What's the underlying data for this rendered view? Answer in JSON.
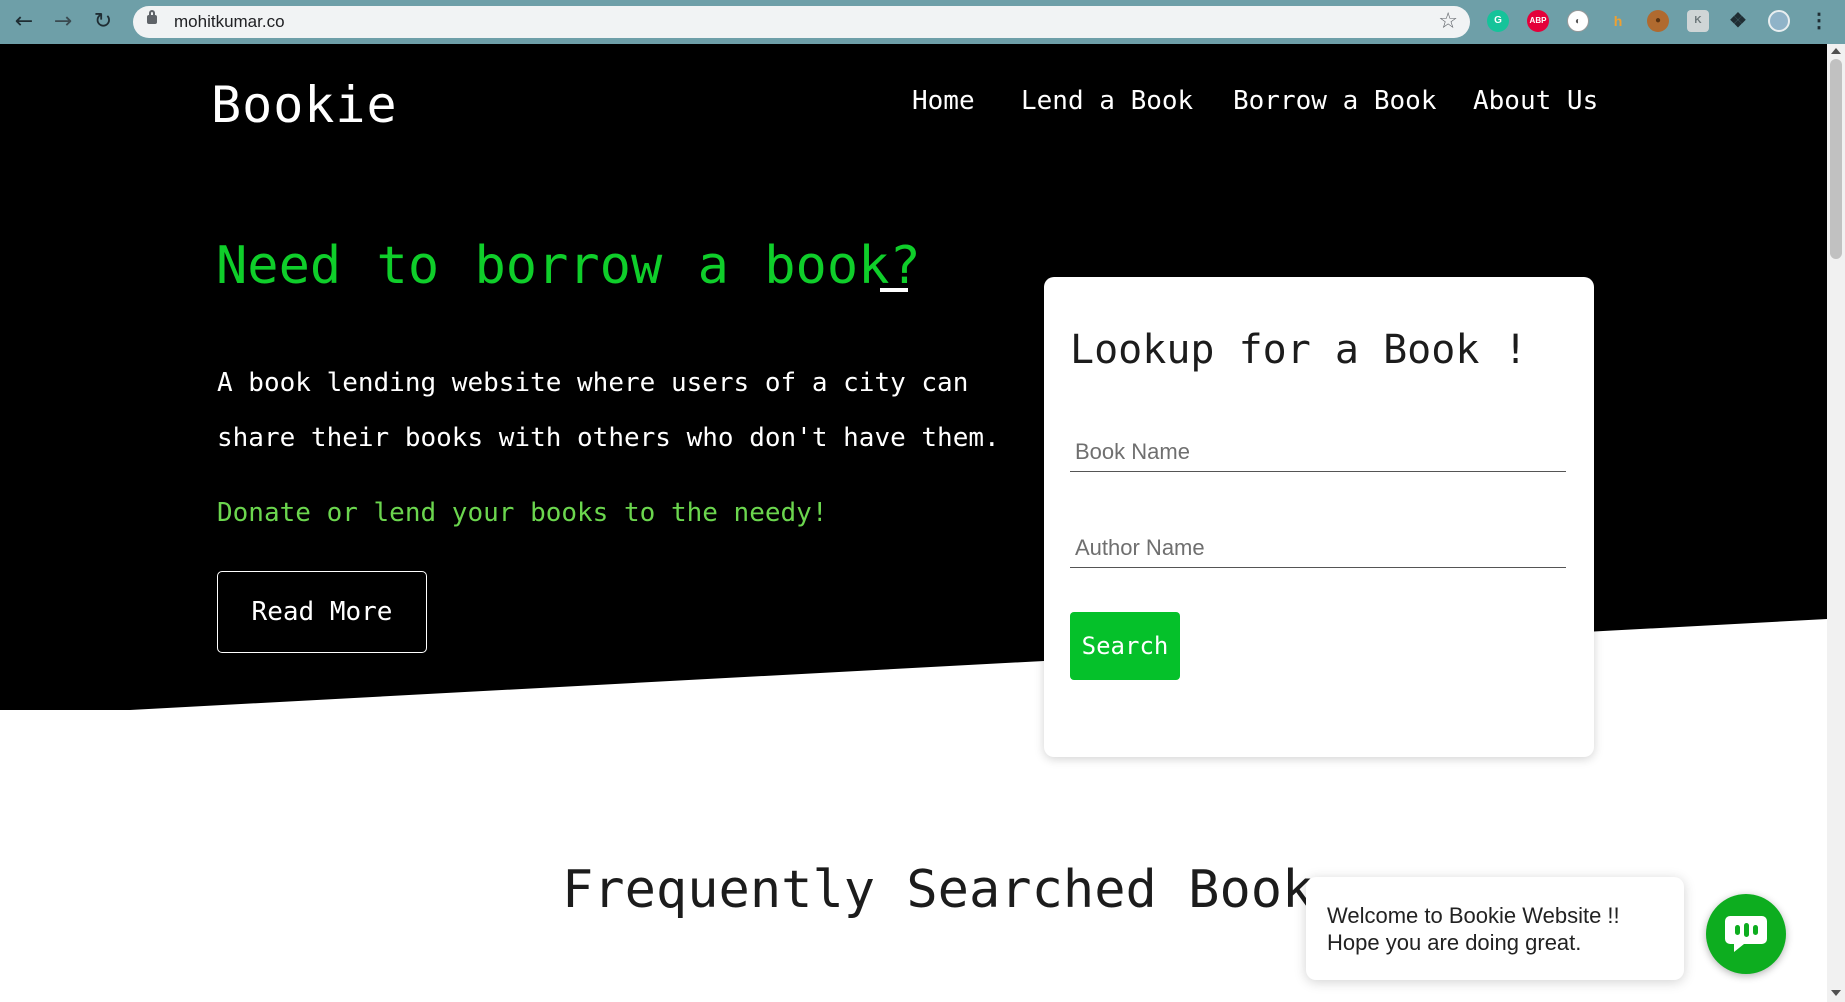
{
  "browser": {
    "url": "mohitkumar.co",
    "extensions": [
      {
        "name": "grammarly-icon",
        "label": "G",
        "color": "#15c39a"
      },
      {
        "name": "adblock-icon",
        "label": "ABP",
        "color": "#e4003a"
      },
      {
        "name": "extension-circle-icon",
        "label": "◐",
        "color": "#ffffff"
      },
      {
        "name": "honey-icon",
        "label": "h",
        "color": "#f0a030"
      },
      {
        "name": "cookie-icon",
        "label": "●",
        "color": "#b06a2f"
      },
      {
        "name": "extension-k-icon",
        "label": "K",
        "color": "#9aa6aa"
      }
    ]
  },
  "site": {
    "logo": "Bookie",
    "nav": [
      "Home",
      "Lend a Book",
      "Borrow a Book",
      "About Us"
    ]
  },
  "hero": {
    "headline": "Need to borrow a book?",
    "description": "A book lending website where users of a city can share their books with others who don't have them.",
    "tagline": "Donate or lend your books to the needy!",
    "cta": "Read More"
  },
  "lookup": {
    "title": "Lookup for a Book !",
    "book_placeholder": "Book Name",
    "author_placeholder": "Author Name",
    "search_label": "Search"
  },
  "section": {
    "title": "Frequently Searched Books"
  },
  "chat": {
    "line1": "Welcome to Bookie Website !!",
    "line2": "Hope you are doing great."
  },
  "colors": {
    "accent_green": "#0fce2a",
    "tagline_green": "#6bd64e",
    "button_green": "#05c12a",
    "hero_bg": "#000000"
  }
}
